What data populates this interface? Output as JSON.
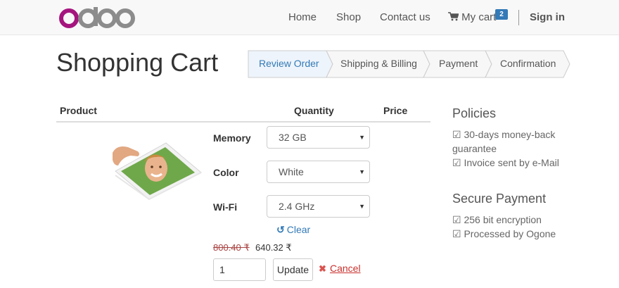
{
  "brand": {
    "logo_text": "odoo",
    "logo_o_color": "#a5157e",
    "logo_gray": "#8c8c8c"
  },
  "nav": {
    "home": "Home",
    "shop": "Shop",
    "contact": "Contact us",
    "cart_label": "My cart",
    "cart_count": "2",
    "signin": "Sign in"
  },
  "page_title": "Shopping Cart",
  "wizard": {
    "steps": [
      "Review Order",
      "Shipping & Billing",
      "Payment",
      "Confirmation"
    ],
    "active_index": 0
  },
  "table": {
    "headers": {
      "product": "Product",
      "quantity": "Quantity",
      "price": "Price"
    }
  },
  "item": {
    "image_icon": "tablet-photo",
    "attributes": [
      {
        "label": "Memory",
        "value": "32 GB"
      },
      {
        "label": "Color",
        "value": "White"
      },
      {
        "label": "Wi-Fi",
        "value": "2.4 GHz"
      }
    ],
    "clear_label": "Clear",
    "old_price": "800.40 ₹",
    "new_price": "640.32 ₹",
    "quantity": "1",
    "update_label": "Update",
    "cancel_label": "Cancel"
  },
  "sidebar": {
    "policies_title": "Policies",
    "policies": [
      "☑ 30-days money-back guarantee",
      "☑ Invoice sent by e-Mail"
    ],
    "payment_title": "Secure Payment",
    "payment": [
      "☑ 256 bit encryption",
      "☑ Processed by Ogone"
    ]
  },
  "colors": {
    "link": "#337ab7",
    "danger": "#d9534f",
    "wizard_active_bg": "#eef4fb"
  }
}
